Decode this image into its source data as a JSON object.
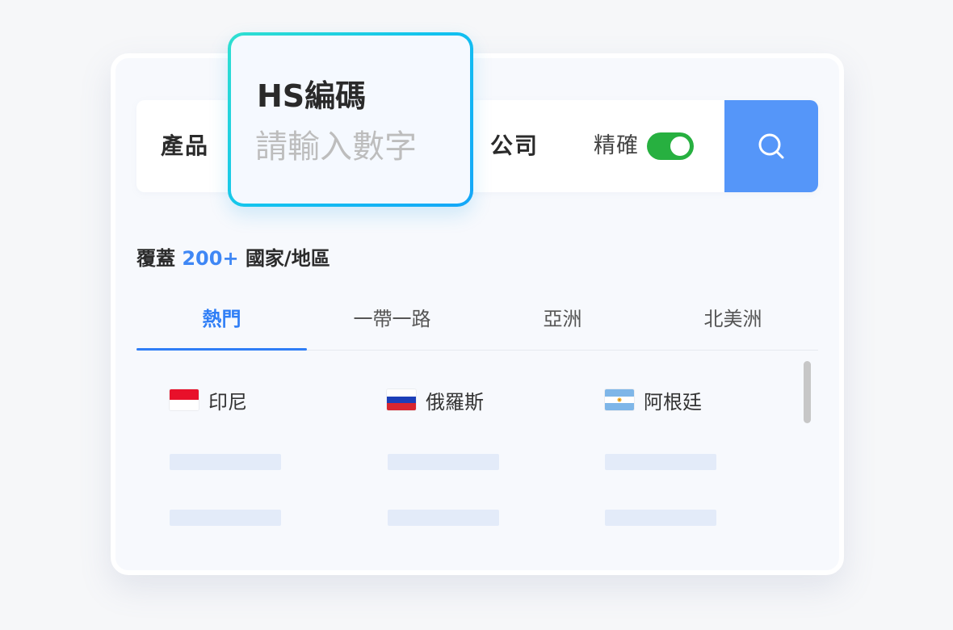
{
  "search": {
    "tabs": [
      "產品",
      "公司"
    ],
    "exact_label": "精確",
    "exact_enabled": true,
    "button_icon": "search-icon"
  },
  "hs_popup": {
    "title": "HS編碼",
    "placeholder": "請輸入數字"
  },
  "coverage": {
    "prefix": "覆蓋",
    "count": "200+",
    "suffix": "國家/地區"
  },
  "region_tabs": [
    "熱門",
    "一帶一路",
    "亞洲",
    "北美洲"
  ],
  "active_region_tab": 0,
  "countries": [
    {
      "name": "印尼",
      "flag": "indonesia-flag"
    },
    {
      "name": "俄羅斯",
      "flag": "russia-flag"
    },
    {
      "name": "阿根廷",
      "flag": "argentina-flag"
    }
  ],
  "colors": {
    "primary": "#2f7ef6",
    "search_button": "#5596f9",
    "toggle_on": "#27b040",
    "popup_border_start": "#2fe0d0",
    "popup_border_end": "#14a6f8",
    "skeleton": "#e3ebf9"
  }
}
